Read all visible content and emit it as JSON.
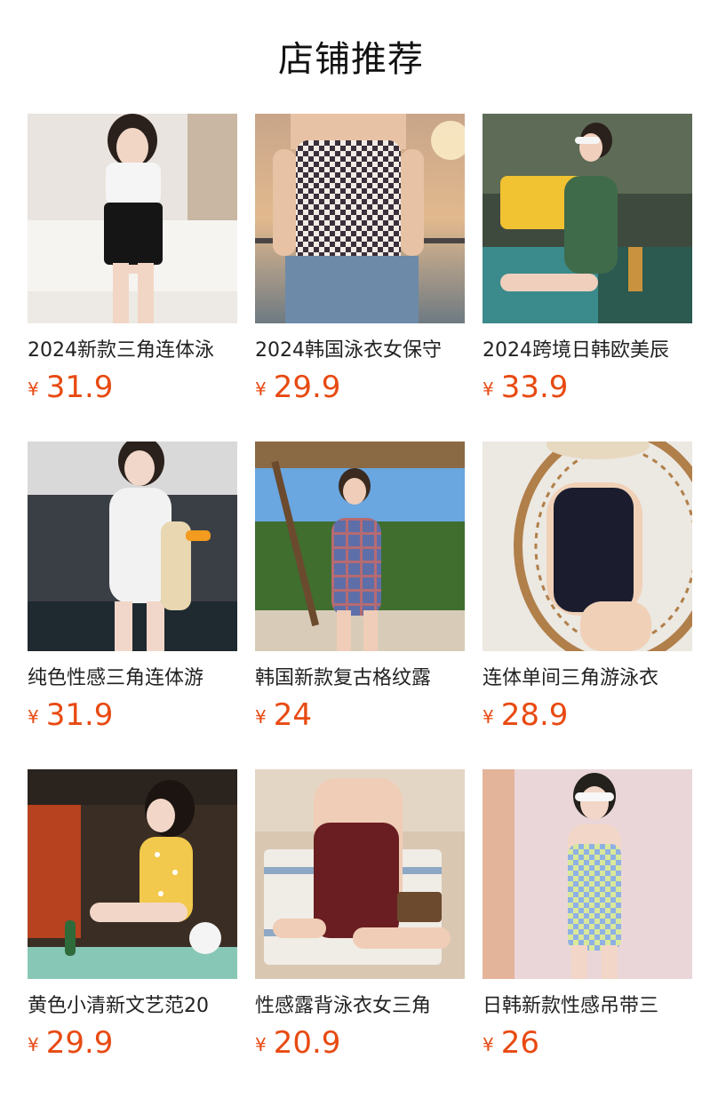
{
  "header": {
    "title": "店铺推荐"
  },
  "currency": "¥",
  "products": [
    {
      "name": "2024新款三角连体泳",
      "price": "31.9",
      "image": "white-black-swimsuit-bedroom"
    },
    {
      "name": "2024韩国泳衣女保守",
      "price": "29.9",
      "image": "checkered-top-sunset"
    },
    {
      "name": "2024跨境日韩欧美辰",
      "price": "33.9",
      "image": "green-swimsuit-poolside"
    },
    {
      "name": "纯色性感三角连体游",
      "price": "31.9",
      "image": "white-ruched-swimsuit"
    },
    {
      "name": "韩国新款复古格纹露",
      "price": "24",
      "image": "plaid-swimsuit-beach"
    },
    {
      "name": "连体单间三角游泳衣",
      "price": "28.9",
      "image": "black-swimsuit-rattan-chair"
    },
    {
      "name": "黄色小清新文艺范20",
      "price": "29.9",
      "image": "yellow-polka-dot-swimsuit"
    },
    {
      "name": "性感露背泳衣女三角",
      "price": "20.9",
      "image": "burgundy-swimsuit-sand"
    },
    {
      "name": "日韩新款性感吊带三",
      "price": "26",
      "image": "checkered-pastel-swimsuit"
    }
  ]
}
